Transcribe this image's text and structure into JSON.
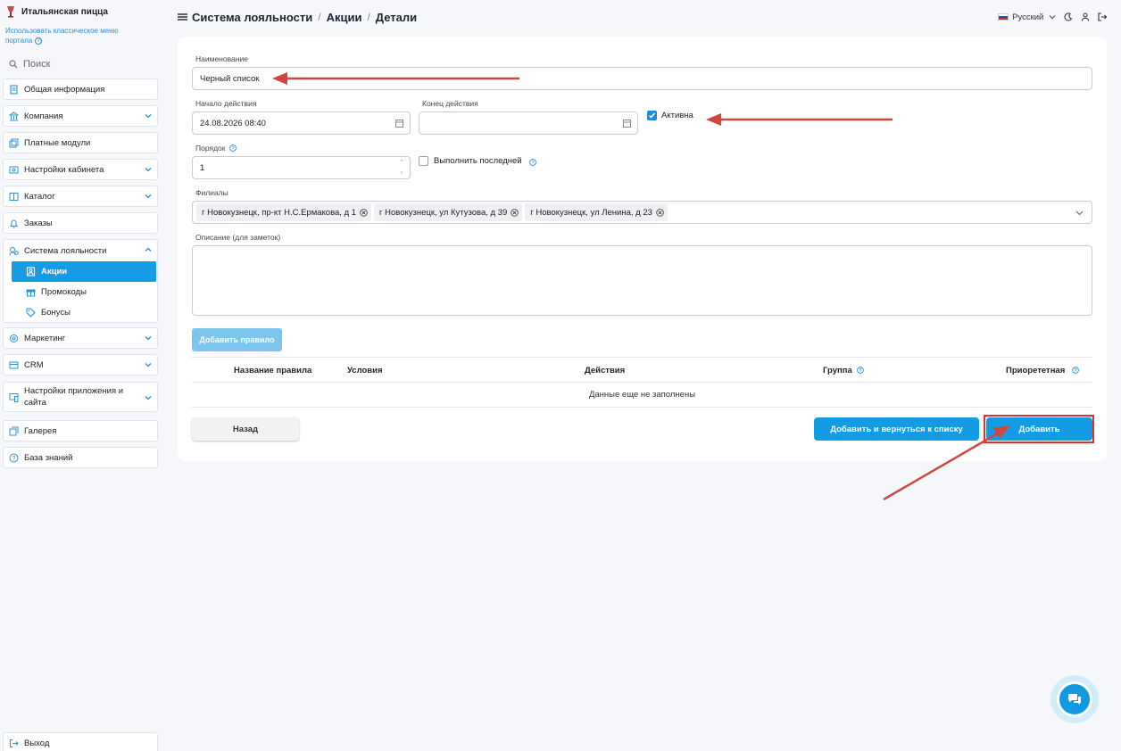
{
  "sidebar": {
    "brand": "Итальянская пицца",
    "classic_link": "Использовать классическое меню портала",
    "search_placeholder": "Поиск",
    "items": [
      {
        "label": "Общая информация",
        "icon": "document-icon"
      },
      {
        "label": "Компания",
        "icon": "building-icon"
      },
      {
        "label": "Платные модули",
        "icon": "modules-icon"
      },
      {
        "label": "Настройки кабинета",
        "icon": "settings-icon"
      },
      {
        "label": "Каталог",
        "icon": "catalog-icon"
      },
      {
        "label": "Заказы",
        "icon": "bell-icon"
      }
    ],
    "loyalty": {
      "label": "Система лояльности",
      "subitems": [
        {
          "label": "Акции",
          "icon": "promo-icon",
          "active": true
        },
        {
          "label": "Промокоды",
          "icon": "gift-icon",
          "active": false
        },
        {
          "label": "Бонусы",
          "icon": "tag-icon",
          "active": false
        }
      ]
    },
    "items_after": [
      {
        "label": "Маркетинг",
        "icon": "marketing-icon"
      },
      {
        "label": "CRM",
        "icon": "crm-icon"
      },
      {
        "label": "Настройки приложения и сайта",
        "icon": "app-settings-icon"
      },
      {
        "label": "Галерея",
        "icon": "gallery-icon"
      },
      {
        "label": "База знаний",
        "icon": "help-icon"
      }
    ],
    "logout": "Выход"
  },
  "header": {
    "breadcrumbs": [
      "Система лояльности",
      "Акции",
      "Детали"
    ],
    "separator": "/",
    "language": "Русский"
  },
  "form": {
    "name_label": "Наименование",
    "name_value": "Черный список",
    "start_label": "Начало действия",
    "start_value": "24.08.2026 08:40",
    "end_label": "Конец действия",
    "end_value": "",
    "active_label": "Активна",
    "active_checked": true,
    "order_label": "Порядок",
    "order_value": "1",
    "run_last_label": "Выполнить последней",
    "run_last_checked": false,
    "branches_label": "Филиалы",
    "branches": [
      "г Новокузнецк, пр-кт Н.С.Ермакова, д 1",
      "г Новокузнецк, ул Кутузова, д 39",
      "г Новокузнецк, ул Ленина, д 23"
    ],
    "description_label": "Описание (для заметок)",
    "description_value": "",
    "add_rule_button": "Добавить правило"
  },
  "rules_table": {
    "columns": [
      "Название правила",
      "Условия",
      "Действия",
      "Группа",
      "Приорететная"
    ],
    "empty_text": "Данные еще не заполнены"
  },
  "actions": {
    "back": "Назад",
    "add_and_return": "Добавить и вернуться к списку",
    "add": "Добавить"
  },
  "colors": {
    "accent": "#139be3",
    "annotation": "#d93030"
  }
}
